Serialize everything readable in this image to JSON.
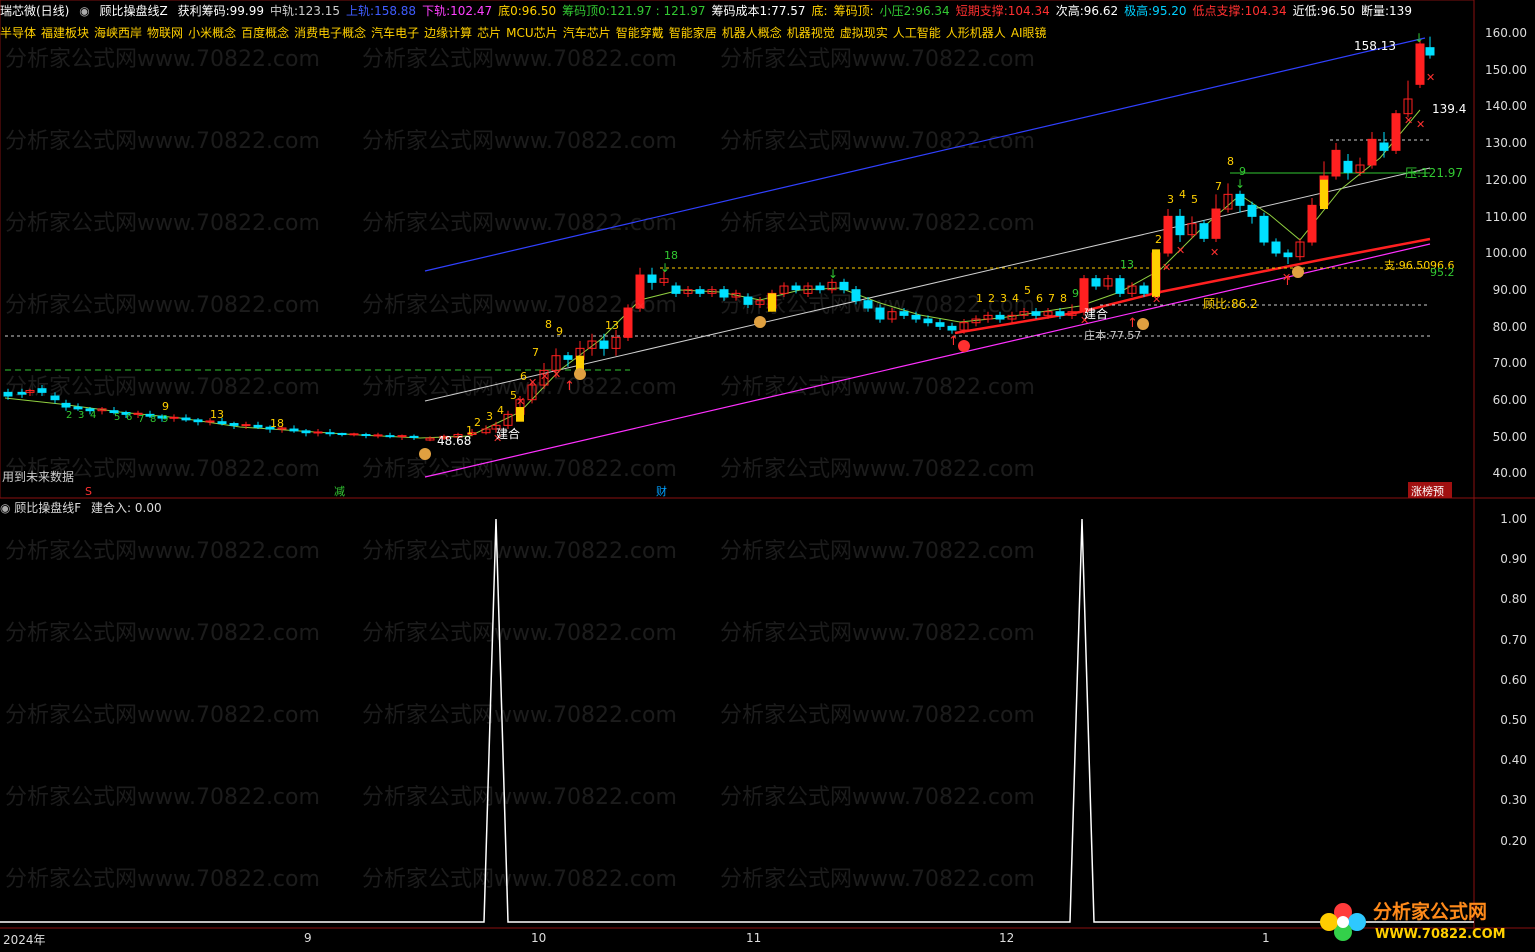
{
  "header": {
    "stock": "瑞芯微(日线)",
    "indicator": "顾比操盘线Z",
    "items": [
      {
        "label": "获利筹码:",
        "value": "99.99",
        "color": "#ffffff"
      },
      {
        "label": "中轨:",
        "value": "123.15",
        "color": "#cccccc"
      },
      {
        "label": "上轨:",
        "value": "158.88",
        "color": "#3f5cff"
      },
      {
        "label": "下轨:",
        "value": "102.47",
        "color": "#ff40ff"
      },
      {
        "label": "底0:",
        "value": "96.50",
        "color": "#ffd000"
      },
      {
        "label": "筹码顶0:",
        "value": "121.97 : 121.97",
        "color": "#32c832"
      },
      {
        "label": "筹码成本1:",
        "value": "77.57",
        "color": "#ffffff"
      },
      {
        "label": "底:",
        "value": "",
        "color": "#ffd000"
      },
      {
        "label": "筹码顶:",
        "value": "",
        "color": "#ffd000"
      },
      {
        "label": "小压2:",
        "value": "96.34",
        "color": "#32c832"
      },
      {
        "label": "短期支撑:",
        "value": "104.34",
        "color": "#ff3030"
      },
      {
        "label": "次高:",
        "value": "96.62",
        "color": "#ffffff"
      },
      {
        "label": "极高:",
        "value": "95.20",
        "color": "#00d0ff"
      },
      {
        "label": "低点支撑:",
        "value": "104.34",
        "color": "#ff3030"
      },
      {
        "label": "近低:",
        "value": "96.50",
        "color": "#ffffff"
      },
      {
        "label": "断量:",
        "value": "139",
        "color": "#ffffff"
      }
    ]
  },
  "concepts": [
    "半导体",
    "福建板块",
    "海峡西岸",
    "物联网",
    "小米概念",
    "百度概念",
    "消费电子概念",
    "汽车电子",
    "边缘计算",
    "芯片",
    "MCU芯片",
    "汽车芯片",
    "智能穿戴",
    "智能家居",
    "机器人概念",
    "机器视觉",
    "虚拟现实",
    "人工智能",
    "人形机器人",
    "AI眼镜"
  ],
  "main_axis": [
    "160.00",
    "150.00",
    "140.00",
    "130.00",
    "120.00",
    "110.00",
    "100.00",
    "90.00",
    "80.00",
    "70.00",
    "60.00",
    "50.00",
    "40.00"
  ],
  "main_labels": {
    "future_data": "用到未来数据",
    "price_top": "158.13",
    "price_1394": "139.4",
    "pressure": "压:121.97",
    "support": "支:96.50",
    "support2": "96.6",
    "support3": "95.2",
    "gubi": "顾比:86.2",
    "cost": "庄本:77.57",
    "low": "48.68",
    "jianhe1": "建合",
    "jianhe2": "建合",
    "bottom_s": "S",
    "bottom_jian": "减",
    "bottom_cai": "财",
    "bottom_rank": "涨榜预"
  },
  "sub": {
    "title": "顾比操盘线F",
    "value_label": "建合入: 0.00",
    "axis": [
      "1.00",
      "0.90",
      "0.80",
      "0.70",
      "0.60",
      "0.50",
      "0.40",
      "0.30",
      "0.20"
    ]
  },
  "dates": [
    "2024年",
    "9",
    "10",
    "11",
    "12",
    "1"
  ],
  "logo": {
    "name": "分析家公式网",
    "url": "WWW.70822.COM"
  },
  "watermark": "分析家公式网www.70822.com",
  "colors": {
    "up": "#ff2020",
    "down": "#00e0ff",
    "upper": "#3040ff",
    "lower": "#ff30ff",
    "mid": "#d0d0d0",
    "yellow": "#ffd000"
  }
}
